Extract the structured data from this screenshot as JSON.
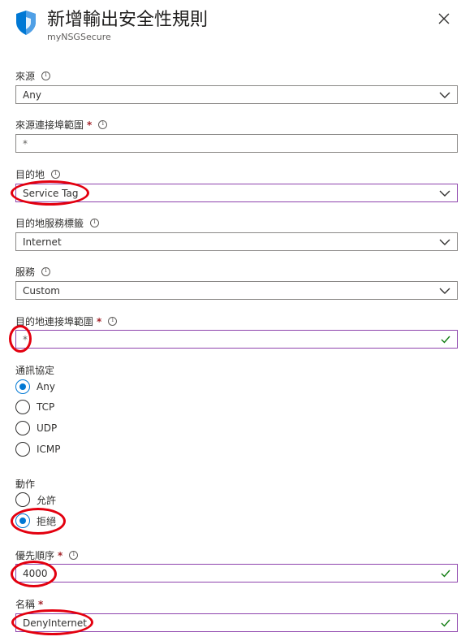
{
  "header": {
    "title": "新增輸出安全性規則",
    "subtitle": "myNSGSecure",
    "icon": "shield-icon",
    "close_icon": "close-icon"
  },
  "source": {
    "label": "來源",
    "value": "Any"
  },
  "source_port": {
    "label": "來源連接埠範圍",
    "required": "*",
    "value": "*"
  },
  "destination": {
    "label": "目的地",
    "value": "Service Tag"
  },
  "destination_tag": {
    "label": "目的地服務標籤",
    "value": "Internet"
  },
  "service": {
    "label": "服務",
    "value": "Custom"
  },
  "destination_port": {
    "label": "目的地連接埠範圍",
    "required": "*",
    "value": "*"
  },
  "protocol": {
    "label": "通訊協定",
    "options": [
      "Any",
      "TCP",
      "UDP",
      "ICMP"
    ],
    "selected": "Any"
  },
  "action": {
    "label": "動作",
    "options": [
      "允許",
      "拒絕"
    ],
    "selected": "拒絕"
  },
  "priority": {
    "label": "優先順序",
    "required": "*",
    "value": "4000"
  },
  "name": {
    "label": "名稱",
    "required": "*",
    "value": "DenyInternet"
  },
  "colors": {
    "accent": "#0078d4",
    "focus_border": "#8e44ad",
    "valid_check": "#107c10",
    "required": "#a4262c",
    "annotation": "#e3000f"
  }
}
